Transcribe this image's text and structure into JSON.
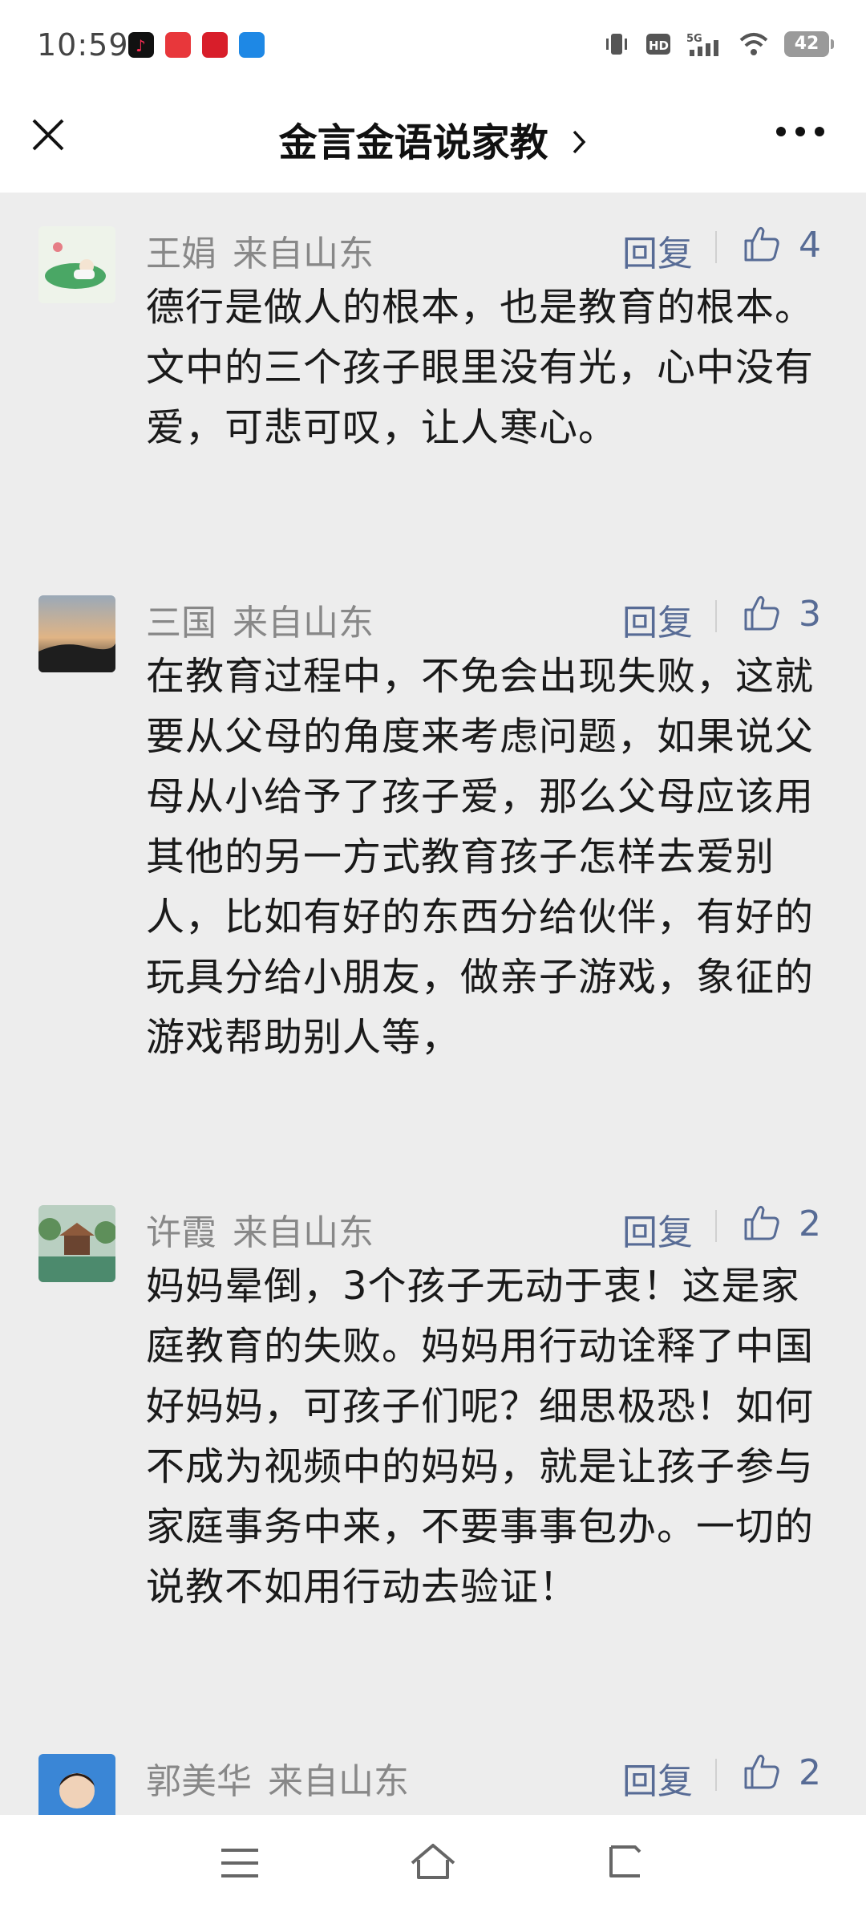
{
  "status_bar": {
    "time": "10:59",
    "app_icons": [
      "douyin-icon",
      "shilu-icon",
      "red-app-icon",
      "blue-bot-icon"
    ],
    "network": "5G",
    "hd_badge": "HD",
    "battery": "42"
  },
  "nav": {
    "title": "金言金语说家教",
    "close_icon": "close-icon",
    "more_icon": "more-icon"
  },
  "comments": [
    {
      "name": "王娟",
      "location": "来自山东",
      "reply": "回复",
      "likes": "4",
      "text": "德行是做人的根本，也是教育的根本。文中的三个孩子眼里没有光，心中没有爱，可悲可叹，让人寒心。"
    },
    {
      "name": "三国",
      "location": "来自山东",
      "reply": "回复",
      "likes": "3",
      "text": "在教育过程中，不免会出现失败，这就要从父母的角度来考虑问题，如果说父母从小给予了孩子爱，那么父母应该用其他的另一方式教育孩子怎样去爱别人，比如有好的东西分给伙伴，有好的玩具分给小朋友，做亲子游戏，象征的游戏帮助别人等，"
    },
    {
      "name": "许霞",
      "location": "来自山东",
      "reply": "回复",
      "likes": "2",
      "text": "妈妈晕倒，3个孩子无动于衷！这是家庭教育的失败。妈妈用行动诠释了中国好妈妈，可孩子们呢？细思极恐！如何不成为视频中的妈妈，就是让孩子参与家庭事务中来，不要事事包办。一切的说教不如用行动去验证！"
    },
    {
      "name": "郭美华",
      "location": "来自山东",
      "reply": "回复",
      "likes": "2",
      "text": ""
    }
  ],
  "colors": {
    "accent": "#576b95",
    "background": "#ededed",
    "name_gray": "#888888"
  }
}
